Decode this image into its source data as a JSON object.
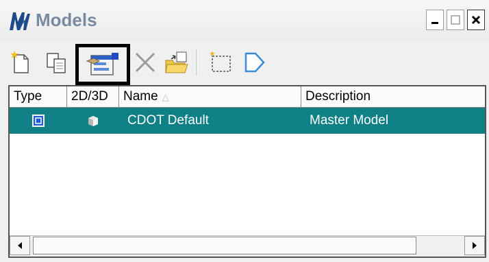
{
  "window": {
    "title": "Models",
    "controls": [
      "minimize",
      "maximize",
      "close"
    ]
  },
  "toolbar": {
    "tools": [
      {
        "name": "create-model",
        "icon": "new-model-icon"
      },
      {
        "name": "copy-model",
        "icon": "copy-model-icon"
      },
      {
        "name": "edit-model-properties",
        "icon": "edit-properties-icon",
        "highlighted": true
      },
      {
        "name": "delete-model",
        "icon": "delete-x-icon"
      },
      {
        "name": "import-model",
        "icon": "folder-import-icon"
      },
      {
        "name": "create-from-selection",
        "icon": "dashed-selection-icon"
      },
      {
        "name": "make-active",
        "icon": "arrow-tag-icon"
      }
    ]
  },
  "list": {
    "columns": [
      {
        "label": "Type"
      },
      {
        "label": "2D/3D"
      },
      {
        "label": "Name",
        "sort_indicator": "△"
      },
      {
        "label": "Description"
      }
    ],
    "rows": [
      {
        "type_icon": "model-type-icon",
        "dim_icon": "3d-cube-icon",
        "name": "CDOT Default",
        "description": "Master Model",
        "selected": true
      }
    ]
  },
  "colors": {
    "selection": "#0f8086",
    "title_text": "#7a8aa0"
  }
}
